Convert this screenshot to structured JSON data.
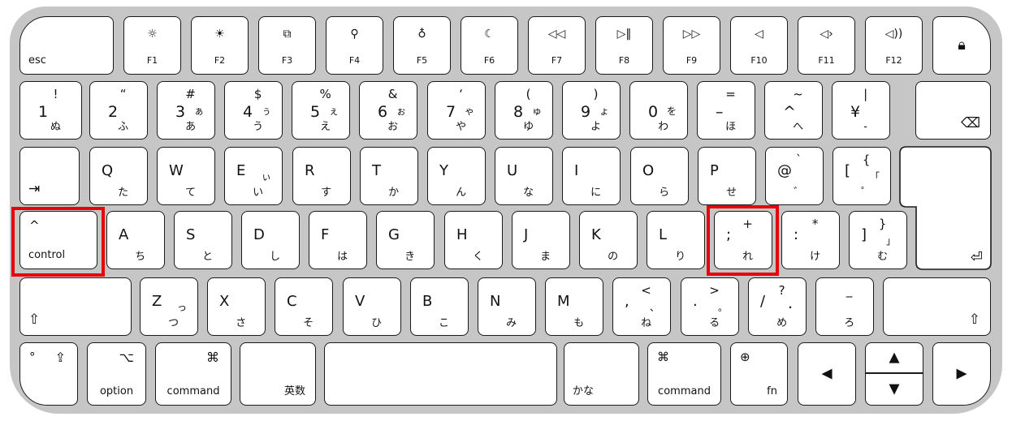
{
  "keyboard": {
    "highlight_color": "#e8000b",
    "highlighted_keys": [
      "control",
      ";"
    ],
    "rows": [
      {
        "keys": [
          {
            "id": "esc",
            "bl": "esc"
          },
          {
            "id": "f1",
            "icon": "brightness-down-icon",
            "label": "F1"
          },
          {
            "id": "f2",
            "icon": "brightness-up-icon",
            "label": "F2"
          },
          {
            "id": "f3",
            "icon": "mission-control-icon",
            "label": "F3"
          },
          {
            "id": "f4",
            "icon": "search-icon",
            "label": "F4"
          },
          {
            "id": "f5",
            "icon": "microphone-icon",
            "label": "F5"
          },
          {
            "id": "f6",
            "icon": "moon-icon",
            "label": "F6"
          },
          {
            "id": "f7",
            "icon": "rewind-icon",
            "label": "F7"
          },
          {
            "id": "f8",
            "icon": "play-pause-icon",
            "label": "F8"
          },
          {
            "id": "f9",
            "icon": "fast-forward-icon",
            "label": "F9"
          },
          {
            "id": "f10",
            "icon": "mute-icon",
            "label": "F10"
          },
          {
            "id": "f11",
            "icon": "volume-down-icon",
            "label": "F11"
          },
          {
            "id": "f12",
            "icon": "volume-up-icon",
            "label": "F12"
          },
          {
            "id": "lock",
            "icon": "lock-icon"
          }
        ]
      },
      {
        "keys": [
          {
            "id": "1",
            "main": "1",
            "top": "!",
            "bottom": "ぬ"
          },
          {
            "id": "2",
            "main": "2",
            "top": "“",
            "bottom": "ふ"
          },
          {
            "id": "3",
            "main": "3",
            "top": "#",
            "right": "ぁ",
            "bottom": "あ"
          },
          {
            "id": "4",
            "main": "4",
            "top": "$",
            "right": "ぅ",
            "bottom": "う"
          },
          {
            "id": "5",
            "main": "5",
            "top": "%",
            "right": "ぇ",
            "bottom": "え"
          },
          {
            "id": "6",
            "main": "6",
            "top": "&",
            "right": "ぉ",
            "bottom": "お"
          },
          {
            "id": "7",
            "main": "7",
            "top": "‘",
            "right": "ゃ",
            "bottom": "や"
          },
          {
            "id": "8",
            "main": "8",
            "top": "(",
            "right": "ゅ",
            "bottom": "ゆ"
          },
          {
            "id": "9",
            "main": "9",
            "top": ")",
            "right": "ょ",
            "bottom": "よ"
          },
          {
            "id": "0",
            "main": "0",
            "right": "を",
            "bottom": "わ"
          },
          {
            "id": "minus",
            "main": "–",
            "top": "=",
            "bottom": "ほ"
          },
          {
            "id": "caret",
            "main": "^",
            "top": "~",
            "bottom": "へ"
          },
          {
            "id": "yen",
            "main": "¥",
            "top": "|",
            "bottom": "-"
          },
          {
            "id": "delete",
            "icon": "delete-icon"
          }
        ]
      },
      {
        "keys": [
          {
            "id": "tab",
            "icon": "tab-icon"
          },
          {
            "id": "q",
            "main": "Q",
            "bottom": "た"
          },
          {
            "id": "w",
            "main": "W",
            "bottom": "て"
          },
          {
            "id": "e",
            "main": "E",
            "right": "ぃ",
            "bottom": "い"
          },
          {
            "id": "r",
            "main": "R",
            "bottom": "す"
          },
          {
            "id": "t",
            "main": "T",
            "bottom": "か"
          },
          {
            "id": "y",
            "main": "Y",
            "bottom": "ん"
          },
          {
            "id": "u",
            "main": "U",
            "bottom": "な"
          },
          {
            "id": "i",
            "main": "I",
            "bottom": "に"
          },
          {
            "id": "o",
            "main": "O",
            "bottom": "ら"
          },
          {
            "id": "p",
            "main": "P",
            "bottom": "せ"
          },
          {
            "id": "at",
            "main": "@",
            "top": "`",
            "bottom": "゛"
          },
          {
            "id": "bracket-left",
            "main": "[",
            "top": "{",
            "right": "「",
            "bottom": "゜"
          }
        ]
      },
      {
        "keys": [
          {
            "id": "control",
            "tl": "^",
            "bl": "control"
          },
          {
            "id": "a",
            "main": "A",
            "bottom": "ち"
          },
          {
            "id": "s",
            "main": "S",
            "bottom": "と"
          },
          {
            "id": "d",
            "main": "D",
            "bottom": "し"
          },
          {
            "id": "f",
            "main": "F",
            "bottom": "は"
          },
          {
            "id": "g",
            "main": "G",
            "bottom": "き"
          },
          {
            "id": "h",
            "main": "H",
            "bottom": "く"
          },
          {
            "id": "j",
            "main": "J",
            "bottom": "ま"
          },
          {
            "id": "k",
            "main": "K",
            "bottom": "の"
          },
          {
            "id": "l",
            "main": "L",
            "bottom": "り"
          },
          {
            "id": "semicolon",
            "main": ";",
            "top": "+",
            "bottom": "れ"
          },
          {
            "id": "colon",
            "main": ":",
            "top": "*",
            "bottom": "け"
          },
          {
            "id": "bracket-right",
            "main": "]",
            "top": "}",
            "right": "」",
            "bottom": "む"
          }
        ]
      },
      {
        "keys": [
          {
            "id": "shift-left",
            "icon": "shift-icon"
          },
          {
            "id": "z",
            "main": "Z",
            "right": "っ",
            "bottom": "つ"
          },
          {
            "id": "x",
            "main": "X",
            "bottom": "さ"
          },
          {
            "id": "c",
            "main": "C",
            "bottom": "そ"
          },
          {
            "id": "v",
            "main": "V",
            "bottom": "ひ"
          },
          {
            "id": "b",
            "main": "B",
            "bottom": "こ"
          },
          {
            "id": "n",
            "main": "N",
            "bottom": "み"
          },
          {
            "id": "m",
            "main": "M",
            "bottom": "も"
          },
          {
            "id": "comma",
            "main": ",",
            "top": "<",
            "right": "、",
            "bottom": "ね"
          },
          {
            "id": "period",
            "main": ".",
            "top": ">",
            "right": "。",
            "bottom": "る"
          },
          {
            "id": "slash",
            "main": "/",
            "top": "?",
            "right": "・",
            "bottom": "め"
          },
          {
            "id": "underscore",
            "top": "_",
            "bottom": "ろ"
          },
          {
            "id": "shift-right",
            "icon": "shift-icon"
          }
        ]
      },
      {
        "keys": [
          {
            "id": "caps-lock",
            "tl": "°",
            "icon": "caps-lock-icon"
          },
          {
            "id": "option",
            "icon": "option-icon",
            "bc": "option"
          },
          {
            "id": "command-left",
            "icon": "command-icon",
            "bc": "command"
          },
          {
            "id": "eisu",
            "br": "英数"
          },
          {
            "id": "space"
          },
          {
            "id": "kana",
            "bl": "かな"
          },
          {
            "id": "command-right",
            "icon": "command-icon",
            "bc": "command"
          },
          {
            "id": "fn",
            "icon": "globe-icon",
            "br": "fn"
          },
          {
            "id": "arrow-left",
            "icon": "arrow-left-icon"
          },
          {
            "id": "arrow-up",
            "icon": "arrow-up-icon"
          },
          {
            "id": "arrow-down",
            "icon": "arrow-down-icon"
          },
          {
            "id": "arrow-right",
            "icon": "arrow-right-icon"
          }
        ]
      }
    ],
    "return_key": {
      "icon": "return-icon"
    }
  }
}
